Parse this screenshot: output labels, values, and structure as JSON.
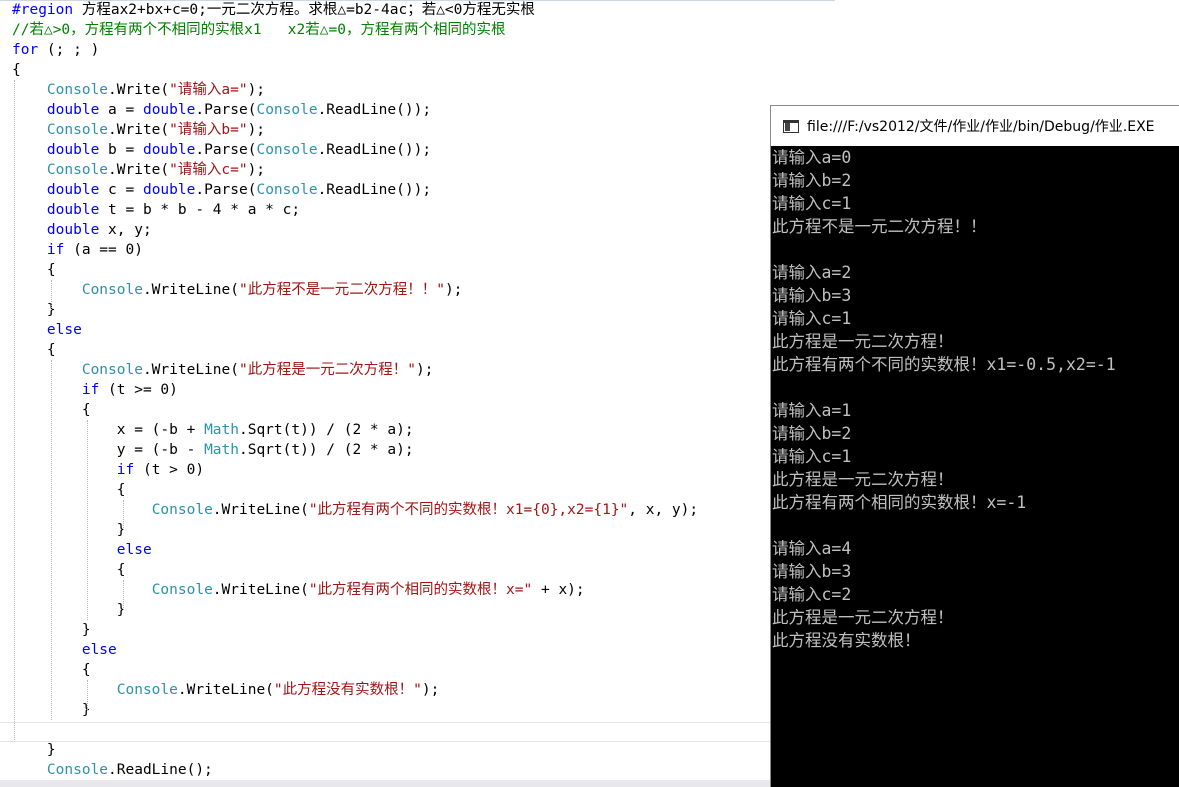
{
  "editor": {
    "lines": [
      [
        {
          "t": "#region",
          "c": "kw"
        },
        {
          "t": " 方程ax2+bx+c=0;一元二次方程。求根△=b2-4ac；若△<0方程无实根",
          "c": ""
        }
      ],
      [
        {
          "t": "//若△>0，方程有两个不相同的实根x1   x2若△=0，方程有两个相同的实根",
          "c": "cm"
        }
      ],
      [
        {
          "t": "for",
          "c": "kw"
        },
        {
          "t": " (; ; )",
          "c": ""
        }
      ],
      [
        {
          "t": "{",
          "c": ""
        }
      ],
      [
        {
          "t": "    ",
          "c": ""
        },
        {
          "t": "Console",
          "c": "ty"
        },
        {
          "t": ".Write(",
          "c": ""
        },
        {
          "t": "\"请输入a=\"",
          "c": "st"
        },
        {
          "t": ");",
          "c": ""
        }
      ],
      [
        {
          "t": "    ",
          "c": ""
        },
        {
          "t": "double",
          "c": "kw"
        },
        {
          "t": " a = ",
          "c": ""
        },
        {
          "t": "double",
          "c": "kw"
        },
        {
          "t": ".Parse(",
          "c": ""
        },
        {
          "t": "Console",
          "c": "ty"
        },
        {
          "t": ".ReadLine());",
          "c": ""
        }
      ],
      [
        {
          "t": "    ",
          "c": ""
        },
        {
          "t": "Console",
          "c": "ty"
        },
        {
          "t": ".Write(",
          "c": ""
        },
        {
          "t": "\"请输入b=\"",
          "c": "st"
        },
        {
          "t": ");",
          "c": ""
        }
      ],
      [
        {
          "t": "    ",
          "c": ""
        },
        {
          "t": "double",
          "c": "kw"
        },
        {
          "t": " b = ",
          "c": ""
        },
        {
          "t": "double",
          "c": "kw"
        },
        {
          "t": ".Parse(",
          "c": ""
        },
        {
          "t": "Console",
          "c": "ty"
        },
        {
          "t": ".ReadLine());",
          "c": ""
        }
      ],
      [
        {
          "t": "    ",
          "c": ""
        },
        {
          "t": "Console",
          "c": "ty"
        },
        {
          "t": ".Write(",
          "c": ""
        },
        {
          "t": "\"请输入c=\"",
          "c": "st"
        },
        {
          "t": ");",
          "c": ""
        }
      ],
      [
        {
          "t": "    ",
          "c": ""
        },
        {
          "t": "double",
          "c": "kw"
        },
        {
          "t": " c = ",
          "c": ""
        },
        {
          "t": "double",
          "c": "kw"
        },
        {
          "t": ".Parse(",
          "c": ""
        },
        {
          "t": "Console",
          "c": "ty"
        },
        {
          "t": ".ReadLine());",
          "c": ""
        }
      ],
      [
        {
          "t": "    ",
          "c": ""
        },
        {
          "t": "double",
          "c": "kw"
        },
        {
          "t": " t = b * b - 4 * a * c;",
          "c": ""
        }
      ],
      [
        {
          "t": "    ",
          "c": ""
        },
        {
          "t": "double",
          "c": "kw"
        },
        {
          "t": " x, y;",
          "c": ""
        }
      ],
      [
        {
          "t": "    ",
          "c": ""
        },
        {
          "t": "if",
          "c": "kw"
        },
        {
          "t": " (a == 0)",
          "c": ""
        }
      ],
      [
        {
          "t": "    {",
          "c": ""
        }
      ],
      [
        {
          "t": "        ",
          "c": ""
        },
        {
          "t": "Console",
          "c": "ty"
        },
        {
          "t": ".WriteLine(",
          "c": ""
        },
        {
          "t": "\"此方程不是一元二次方程！！\"",
          "c": "st"
        },
        {
          "t": ");",
          "c": ""
        }
      ],
      [
        {
          "t": "    }",
          "c": ""
        }
      ],
      [
        {
          "t": "    ",
          "c": ""
        },
        {
          "t": "else",
          "c": "kw"
        }
      ],
      [
        {
          "t": "    {",
          "c": ""
        }
      ],
      [
        {
          "t": "        ",
          "c": ""
        },
        {
          "t": "Console",
          "c": "ty"
        },
        {
          "t": ".WriteLine(",
          "c": ""
        },
        {
          "t": "\"此方程是一元二次方程！\"",
          "c": "st"
        },
        {
          "t": ");",
          "c": ""
        }
      ],
      [
        {
          "t": "        ",
          "c": ""
        },
        {
          "t": "if",
          "c": "kw"
        },
        {
          "t": " (t >= 0)",
          "c": ""
        }
      ],
      [
        {
          "t": "        {",
          "c": ""
        }
      ],
      [
        {
          "t": "            x = (-b + ",
          "c": ""
        },
        {
          "t": "Math",
          "c": "ty"
        },
        {
          "t": ".Sqrt(t)) / (2 * a);",
          "c": ""
        }
      ],
      [
        {
          "t": "            y = (-b - ",
          "c": ""
        },
        {
          "t": "Math",
          "c": "ty"
        },
        {
          "t": ".Sqrt(t)) / (2 * a);",
          "c": ""
        }
      ],
      [
        {
          "t": "            ",
          "c": ""
        },
        {
          "t": "if",
          "c": "kw"
        },
        {
          "t": " (t > 0)",
          "c": ""
        }
      ],
      [
        {
          "t": "            {",
          "c": ""
        }
      ],
      [
        {
          "t": "                ",
          "c": ""
        },
        {
          "t": "Console",
          "c": "ty"
        },
        {
          "t": ".WriteLine(",
          "c": ""
        },
        {
          "t": "\"此方程有两个不同的实数根！x1={0},x2={1}\"",
          "c": "st"
        },
        {
          "t": ", x, y);",
          "c": ""
        }
      ],
      [
        {
          "t": "            }",
          "c": ""
        }
      ],
      [
        {
          "t": "            ",
          "c": ""
        },
        {
          "t": "else",
          "c": "kw"
        }
      ],
      [
        {
          "t": "            {",
          "c": ""
        }
      ],
      [
        {
          "t": "                ",
          "c": ""
        },
        {
          "t": "Console",
          "c": "ty"
        },
        {
          "t": ".WriteLine(",
          "c": ""
        },
        {
          "t": "\"此方程有两个相同的实数根！x=\"",
          "c": "st"
        },
        {
          "t": " + x);",
          "c": ""
        }
      ],
      [
        {
          "t": "            }",
          "c": ""
        }
      ],
      [
        {
          "t": "        }",
          "c": ""
        }
      ],
      [
        {
          "t": "        ",
          "c": ""
        },
        {
          "t": "else",
          "c": "kw"
        }
      ],
      [
        {
          "t": "        {",
          "c": ""
        }
      ],
      [
        {
          "t": "            ",
          "c": ""
        },
        {
          "t": "Console",
          "c": "ty"
        },
        {
          "t": ".WriteLine(",
          "c": ""
        },
        {
          "t": "\"此方程没有实数根！\"",
          "c": "st"
        },
        {
          "t": ");",
          "c": ""
        }
      ],
      [
        {
          "t": "        }",
          "c": ""
        }
      ],
      [
        {
          "t": "",
          "c": ""
        }
      ],
      [
        {
          "t": "    }",
          "c": ""
        }
      ],
      [
        {
          "t": "    ",
          "c": ""
        },
        {
          "t": "Console",
          "c": "ty"
        },
        {
          "t": ".ReadLine();",
          "c": ""
        }
      ]
    ]
  },
  "console": {
    "title": "file:///F:/vs2012/文件/作业/作业/bin/Debug/作业.EXE",
    "output": [
      "请输入a=0",
      "请输入b=2",
      "请输入c=1",
      "此方程不是一元二次方程！！",
      "",
      "请输入a=2",
      "请输入b=3",
      "请输入c=1",
      "此方程是一元二次方程！",
      "此方程有两个不同的实数根！x1=-0.5,x2=-1",
      "",
      "请输入a=1",
      "请输入b=2",
      "请输入c=1",
      "此方程是一元二次方程！",
      "此方程有两个相同的实数根！x=-1",
      "",
      "请输入a=4",
      "请输入b=3",
      "请输入c=2",
      "此方程是一元二次方程！",
      "此方程没有实数根！"
    ]
  },
  "colors": {
    "keyword": "#0000ff",
    "type": "#2b91af",
    "string": "#a31515",
    "comment": "#008000",
    "console_bg": "#000000",
    "console_text": "#c0c0c0"
  }
}
